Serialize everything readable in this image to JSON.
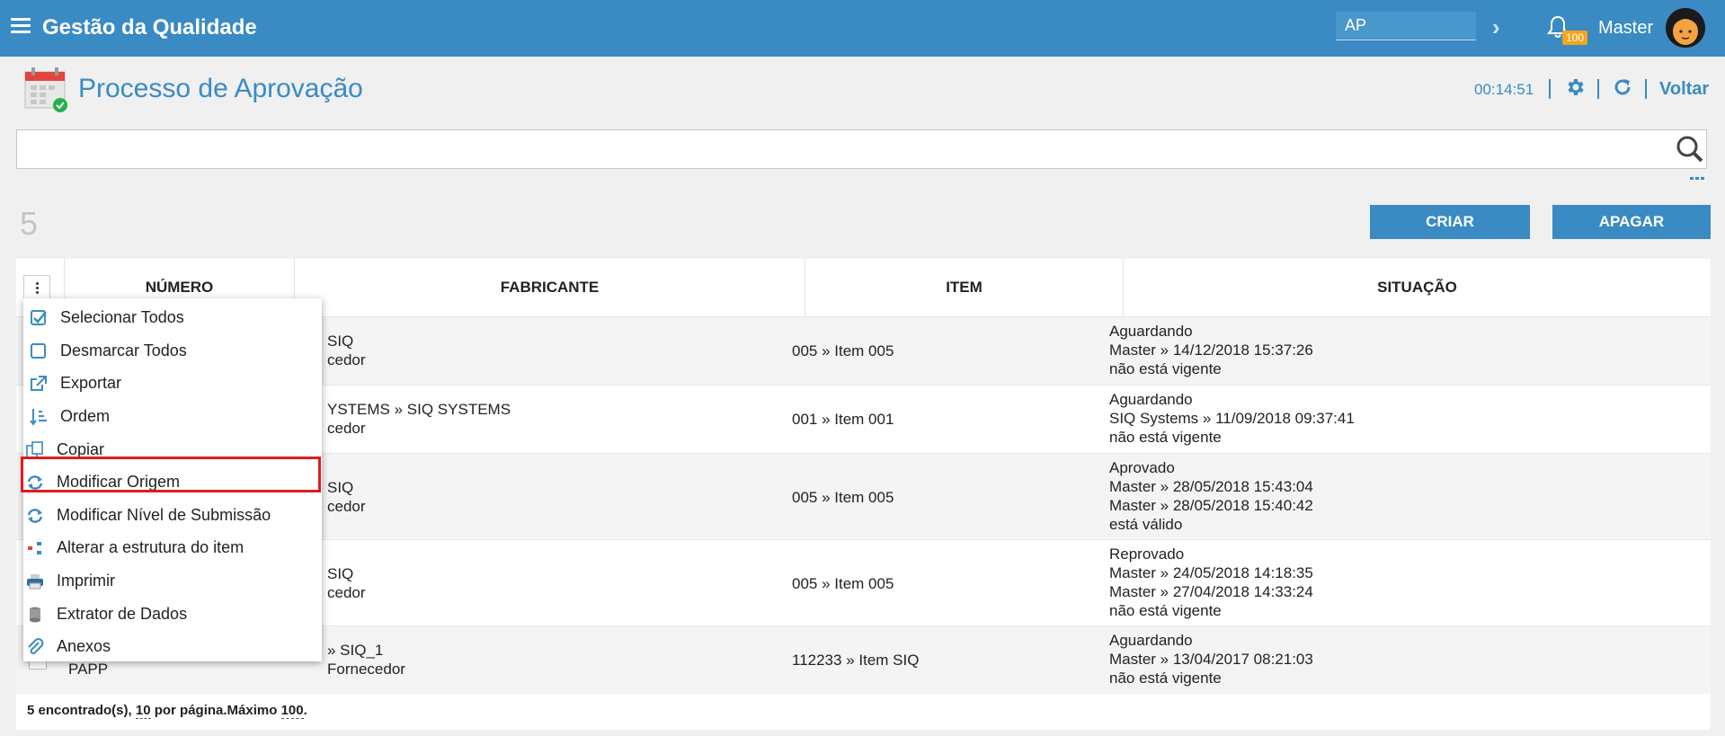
{
  "header": {
    "app_title": "Gestão da Qualidade",
    "ap_value": "AP",
    "notification_count": "100",
    "user_name": "Master"
  },
  "page": {
    "title": "Processo de Aprovação",
    "timer": "00:14:51",
    "voltar": "Voltar",
    "record_count": "5"
  },
  "buttons": {
    "criar": "CRIAR",
    "apagar": "APAGAR"
  },
  "table": {
    "headers": [
      "NÚMERO",
      "FABRICANTE",
      "ITEM",
      "SITUAÇÃO"
    ],
    "rows": [
      {
        "numero": "",
        "fabricante": [
          "SIQ",
          "cedor"
        ],
        "item": "005 » Item 005",
        "situacao": [
          "Aguardando",
          "Master » 14/12/2018 15:37:26",
          "não está vigente"
        ]
      },
      {
        "numero": "",
        "fabricante": [
          "YSTEMS » SIQ SYSTEMS",
          "cedor"
        ],
        "item": "001 » Item 001",
        "situacao": [
          "Aguardando",
          "SIQ Systems » 11/09/2018 09:37:41",
          "não está vigente"
        ]
      },
      {
        "numero": "",
        "fabricante": [
          "SIQ",
          "cedor"
        ],
        "item": "005 » Item 005",
        "situacao": [
          "Aprovado",
          "Master » 28/05/2018 15:43:04",
          "Master » 28/05/2018 15:40:42",
          "está válido"
        ]
      },
      {
        "numero": "",
        "fabricante": [
          "SIQ",
          "cedor"
        ],
        "item": "005 » Item 005",
        "situacao": [
          "Reprovado",
          "Master » 24/05/2018 14:18:35",
          "Master » 27/04/2018 14:33:24",
          "não está vigente"
        ]
      },
      {
        "numero": "PAPP",
        "fabricante": [
          "» SIQ_1",
          "Fornecedor"
        ],
        "item": "112233 » Item SIQ",
        "situacao": [
          "Aguardando",
          "Master » 13/04/2017 08:21:03",
          "não está vigente"
        ]
      }
    ],
    "footer": {
      "found": "5 encontrado(s), ",
      "per_page": "10",
      "per_page_label": " por página.Máximo ",
      "max": "100",
      "end": "."
    }
  },
  "context_menu": {
    "items": [
      {
        "label": "Selecionar Todos",
        "icon": "check-square-icon"
      },
      {
        "label": "Desmarcar Todos",
        "icon": "square-icon"
      },
      {
        "label": "Exportar",
        "icon": "external-link-icon"
      },
      {
        "label": "Ordem",
        "icon": "sort-icon"
      },
      {
        "label": "Copiar",
        "icon": "copy-icon"
      },
      {
        "label": "Modificar Origem",
        "icon": "sync-icon"
      },
      {
        "label": "Modificar Nível de Submissão",
        "icon": "sync-icon"
      },
      {
        "label": "Alterar a estrutura do item",
        "icon": "structure-icon"
      },
      {
        "label": "Imprimir",
        "icon": "printer-icon"
      },
      {
        "label": "Extrator de Dados",
        "icon": "database-icon"
      },
      {
        "label": "Anexos",
        "icon": "paperclip-icon"
      }
    ],
    "highlighted": "Modificar Origem"
  },
  "colors": {
    "primary": "#3a8bc3",
    "badge": "#f3a51e",
    "highlight": "#e01b1b"
  }
}
